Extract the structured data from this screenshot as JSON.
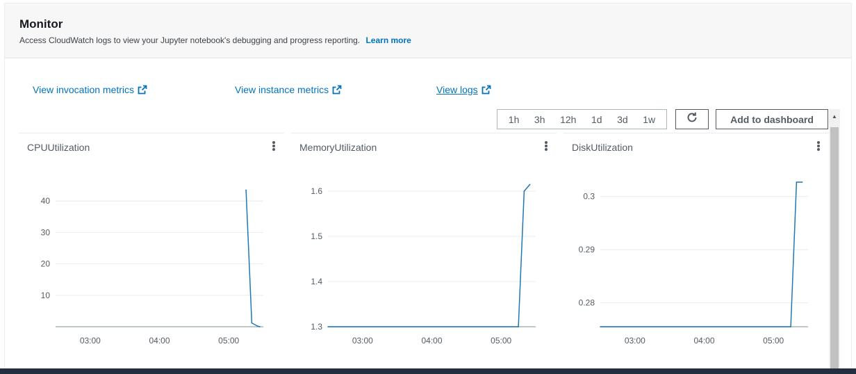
{
  "header": {
    "title": "Monitor",
    "description": "Access CloudWatch logs to view your Jupyter notebook's debugging and progress reporting.",
    "learn_more": "Learn more"
  },
  "links": {
    "invocation": "View invocation metrics",
    "instance": "View instance metrics",
    "logs": "View logs"
  },
  "toolbar": {
    "ranges": [
      "1h",
      "3h",
      "12h",
      "1d",
      "3d",
      "1w"
    ],
    "refresh_icon": "refresh-icon",
    "add_to_dashboard": "Add to dashboard"
  },
  "colors": {
    "link": "#0073bb",
    "series": "#1f77b4",
    "grid": "#e9ebed",
    "axis": "#aab7b8"
  },
  "chart_data": [
    {
      "type": "line",
      "title": "CPUUtilization",
      "x_ticks": [
        "03:00",
        "04:00",
        "05:00"
      ],
      "y_ticks": [
        10,
        20,
        30,
        40
      ],
      "ylim": [
        0,
        46
      ],
      "x": [
        "02:30",
        "05:15",
        "05:20",
        "05:25",
        "05:27"
      ],
      "series": [
        {
          "values": [
            null,
            43.5,
            1.2,
            0.2,
            0
          ]
        }
      ],
      "grid": true
    },
    {
      "type": "line",
      "title": "MemoryUtilization",
      "x_ticks": [
        "03:00",
        "04:00",
        "05:00"
      ],
      "y_ticks": [
        1.3,
        1.4,
        1.5,
        1.6
      ],
      "ylim": [
        1.3,
        1.62
      ],
      "x": [
        "02:30",
        "05:15",
        "05:20",
        "05:25"
      ],
      "series": [
        {
          "values": [
            1.3,
            1.3,
            1.6,
            1.615
          ]
        }
      ],
      "grid": true
    },
    {
      "type": "line",
      "title": "DiskUtilization",
      "x_ticks": [
        "03:00",
        "04:00",
        "05:00"
      ],
      "y_ticks": [
        0.28,
        0.29,
        0.3
      ],
      "ylim": [
        0.2755,
        0.3027
      ],
      "x": [
        "02:30",
        "05:15",
        "05:20",
        "05:25"
      ],
      "series": [
        {
          "values": [
            0.2755,
            0.2755,
            0.3027,
            0.3027
          ]
        }
      ],
      "grid": true
    }
  ]
}
